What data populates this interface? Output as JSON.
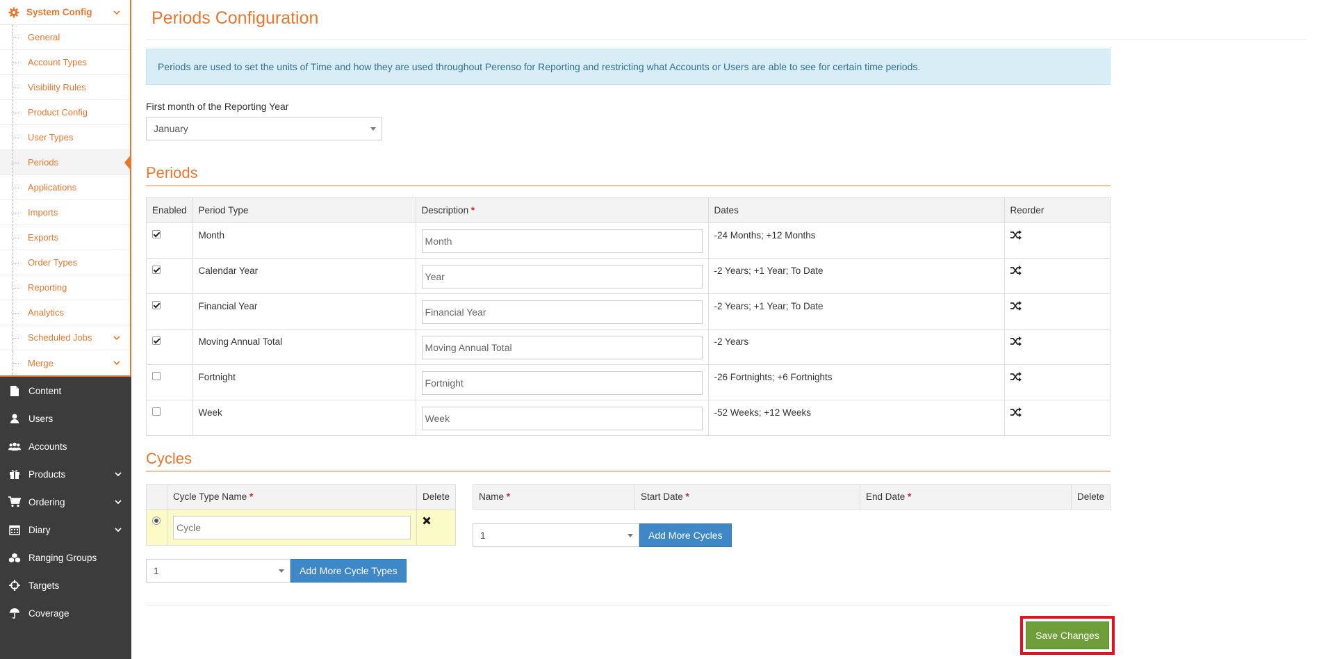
{
  "sidebar": {
    "system_config": {
      "label": "System Config"
    },
    "sub_items": [
      {
        "label": "General"
      },
      {
        "label": "Account Types"
      },
      {
        "label": "Visibility Rules"
      },
      {
        "label": "Product Config"
      },
      {
        "label": "User Types"
      },
      {
        "label": "Periods",
        "active": true
      },
      {
        "label": "Applications"
      },
      {
        "label": "Imports"
      },
      {
        "label": "Exports"
      },
      {
        "label": "Order Types"
      },
      {
        "label": "Reporting"
      },
      {
        "label": "Analytics"
      },
      {
        "label": "Scheduled Jobs",
        "has_submenu": true
      },
      {
        "label": "Merge",
        "has_submenu": true
      }
    ],
    "main_items": [
      {
        "label": "Content",
        "icon": "file-icon"
      },
      {
        "label": "Users",
        "icon": "user-icon"
      },
      {
        "label": "Accounts",
        "icon": "users-group-icon"
      },
      {
        "label": "Products",
        "icon": "gift-icon",
        "has_submenu": true
      },
      {
        "label": "Ordering",
        "icon": "cart-icon",
        "has_submenu": true
      },
      {
        "label": "Diary",
        "icon": "calendar-icon",
        "has_submenu": true
      },
      {
        "label": "Ranging Groups",
        "icon": "cubes-icon"
      },
      {
        "label": "Targets",
        "icon": "crosshairs-icon"
      },
      {
        "label": "Coverage",
        "icon": "umbrella-icon"
      }
    ]
  },
  "page": {
    "title": "Periods Configuration",
    "info": "Periods are used to set the units of Time and how they are used throughout Perenso for Reporting and restricting what Accounts or Users are able to see for certain time periods.",
    "first_month_label": "First month of the Reporting Year",
    "first_month_value": "January"
  },
  "periods": {
    "title": "Periods",
    "headers": {
      "enabled": "Enabled",
      "type": "Period Type",
      "description": "Description",
      "required": "*",
      "dates": "Dates",
      "reorder": "Reorder"
    },
    "rows": [
      {
        "enabled": true,
        "type": "Month",
        "description": "Month",
        "dates": "-24 Months; +12 Months"
      },
      {
        "enabled": true,
        "type": "Calendar Year",
        "description": "Year",
        "dates": "-2 Years; +1 Year; To Date"
      },
      {
        "enabled": true,
        "type": "Financial Year",
        "description": "Financial Year",
        "dates": "-2 Years; +1 Year; To Date"
      },
      {
        "enabled": true,
        "type": "Moving Annual Total",
        "description": "Moving Annual Total",
        "dates": "-2 Years"
      },
      {
        "enabled": false,
        "type": "Fortnight",
        "description": "Fortnight",
        "dates": "-26 Fortnights; +6 Fortnights"
      },
      {
        "enabled": false,
        "type": "Week",
        "description": "Week",
        "dates": "-52 Weeks; +12 Weeks"
      }
    ]
  },
  "cycles": {
    "title": "Cycles",
    "type_headers": {
      "name": "Cycle Type Name",
      "required": "*",
      "delete": "Delete"
    },
    "type_rows": [
      {
        "selected": true,
        "placeholder": "Cycle"
      }
    ],
    "cycle_headers": {
      "name": "Name",
      "start": "Start Date",
      "end": "End Date",
      "required": "*",
      "delete": "Delete"
    },
    "add_cycles_count": "1",
    "add_cycles_label": "Add More Cycles",
    "add_types_count": "1",
    "add_types_label": "Add More Cycle Types"
  },
  "footer": {
    "save_label": "Save Changes"
  },
  "colors": {
    "accent": "#e8772e",
    "primary_button": "#3f88c8",
    "save_button": "#6f9d3a",
    "sidebar_dark": "#3c3c3c"
  }
}
